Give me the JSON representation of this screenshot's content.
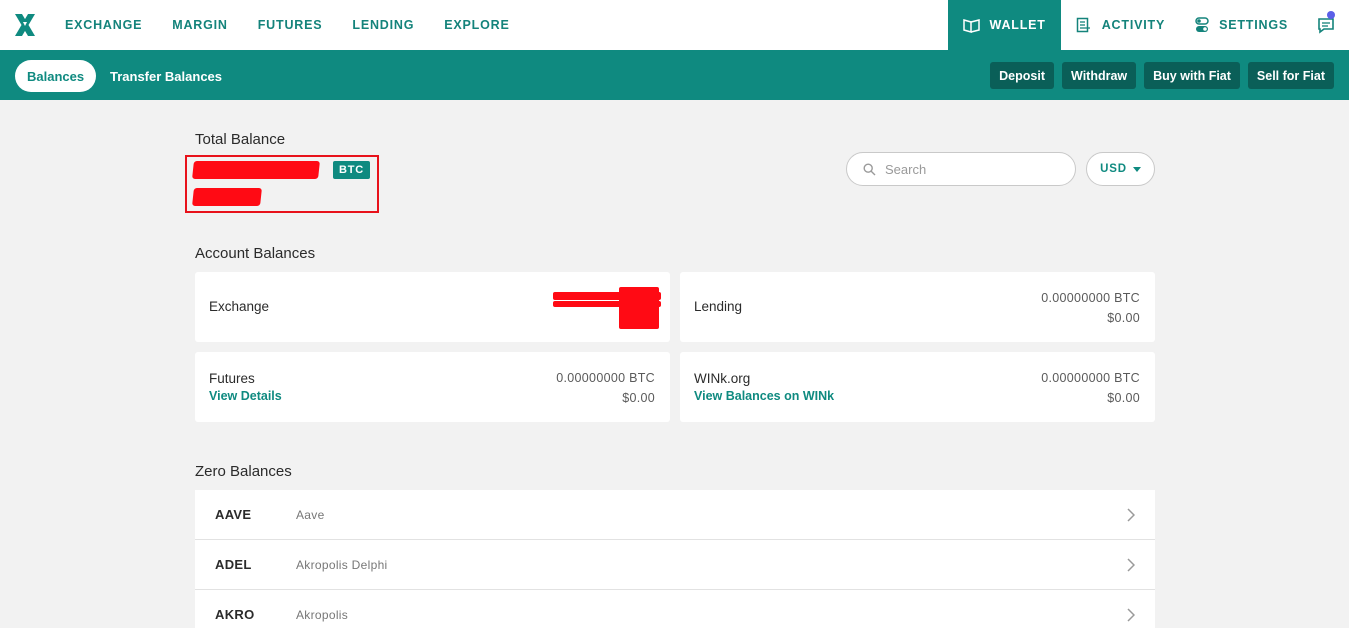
{
  "topnav": {
    "links": [
      "EXCHANGE",
      "MARGIN",
      "FUTURES",
      "LENDING",
      "EXPLORE"
    ],
    "wallet": "WALLET",
    "activity": "ACTIVITY",
    "settings": "SETTINGS"
  },
  "subnav": {
    "balances": "Balances",
    "transfer": "Transfer Balances",
    "actions": [
      "Deposit",
      "Withdraw",
      "Buy with Fiat",
      "Sell for Fiat"
    ]
  },
  "total": {
    "heading": "Total Balance",
    "badge": "BTC"
  },
  "search": {
    "placeholder": "Search"
  },
  "currency": {
    "selected": "USD"
  },
  "accounts": {
    "heading": "Account Balances",
    "exchange": {
      "name": "Exchange"
    },
    "lending": {
      "name": "Lending",
      "btc": "0.00000000 BTC",
      "usd": "$0.00"
    },
    "futures": {
      "name": "Futures",
      "link": "View Details",
      "btc": "0.00000000 BTC",
      "usd": "$0.00"
    },
    "wink": {
      "name": "WINk.org",
      "link": "View Balances on WINk",
      "btc": "0.00000000 BTC",
      "usd": "$0.00"
    }
  },
  "zero": {
    "heading": "Zero Balances",
    "rows": [
      {
        "symbol": "AAVE",
        "name": "Aave"
      },
      {
        "symbol": "ADEL",
        "name": "Akropolis Delphi"
      },
      {
        "symbol": "AKRO",
        "name": "Akropolis"
      }
    ]
  },
  "colors": {
    "brand": "#0f8a80",
    "brand_dark": "#0a5f58",
    "notification": "#5b5fe8",
    "redaction": "#ff0a14"
  }
}
